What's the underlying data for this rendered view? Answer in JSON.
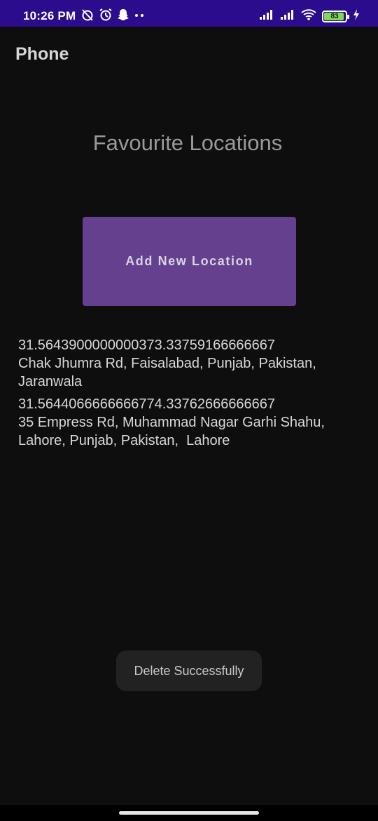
{
  "status_bar": {
    "time": "10:26 PM",
    "battery_percent": "83",
    "background_color": "#2a0c8c",
    "left_icons": [
      "alarm-off-icon",
      "alarm-icon",
      "snapchat-icon",
      "more-dots-icon"
    ],
    "right_icons": [
      "signal-1-icon",
      "signal-2-icon",
      "wifi-icon",
      "battery-icon",
      "charging-icon"
    ]
  },
  "app_bar": {
    "title": "Phone"
  },
  "main": {
    "heading": "Favourite Locations",
    "add_button_label": "Add New Location",
    "button_color": "#65408f",
    "locations": [
      {
        "coords": "31.5643900000000373.33759166666667",
        "address_line1": "Chak Jhumra Rd, Faisalabad, Punjab, Pakistan,",
        "address_line2": "Jaranwala"
      },
      {
        "coords": "31.5644066666666774.33762666666667",
        "address_line1": "35 Empress Rd, Muhammad Nagar Garhi Shahu,",
        "address_line2": "Lahore, Punjab, Pakistan,  Lahore"
      }
    ]
  },
  "toast": {
    "message": "Delete Successfully"
  }
}
